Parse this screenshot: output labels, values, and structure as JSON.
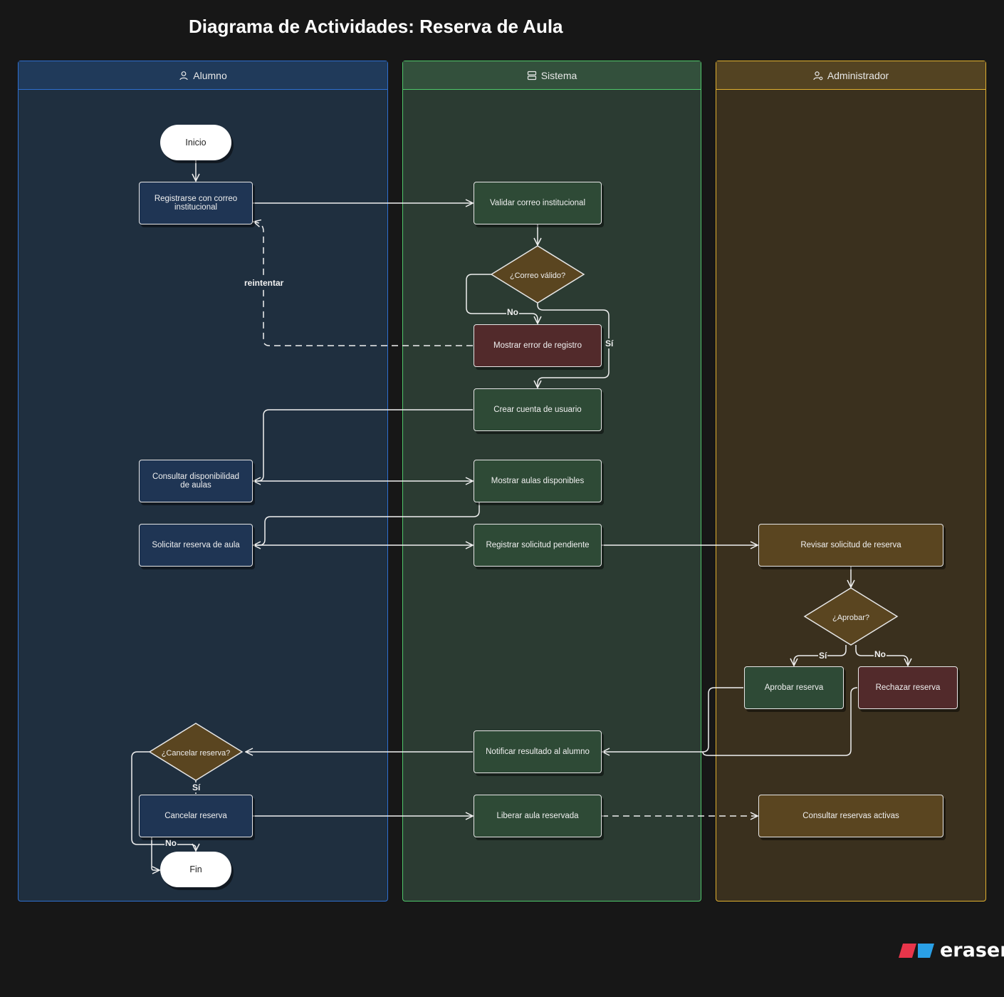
{
  "title": "Diagrama de Actividades: Reserva de Aula",
  "colors": {
    "background": "#171717",
    "alumno_lane_bg": "#1f2f3f",
    "alumno_lane_border": "#2f6fd0",
    "sistema_lane_bg": "#2b3b32",
    "sistema_lane_border": "#4fc76a",
    "admin_lane_bg": "#3a301e",
    "admin_lane_border": "#e0b030",
    "blue_node": "#1f3554",
    "green_node": "#2e4a36",
    "red_node": "#522a2b",
    "gold_node": "#5a4520"
  },
  "lanes": [
    {
      "label": "Alumno",
      "icon": "user-icon"
    },
    {
      "label": "Sistema",
      "icon": "server-icon"
    },
    {
      "label": "Administrador",
      "icon": "user-gear-icon"
    }
  ],
  "nodes": {
    "inicio": "Inicio",
    "registrarse": "Registrarse con correo institucional",
    "validar": "Validar correo institucional",
    "correo_valido": "¿Correo válido?",
    "mostrar_error": "Mostrar error de registro",
    "crear_cuenta": "Crear cuenta de usuario",
    "consultar_disponibilidad": "Consultar disponibilidad de aulas",
    "mostrar_aulas": "Mostrar aulas disponibles",
    "solicitar_reserva": "Solicitar reserva de aula",
    "registrar_solicitud": "Registrar solicitud pendiente",
    "revisar_solicitud": "Revisar solicitud de reserva",
    "aprobar_q": "¿Aprobar?",
    "aprobar_reserva": "Aprobar reserva",
    "rechazar_reserva": "Rechazar reserva",
    "notificar": "Notificar resultado al alumno",
    "cancelar_q": "¿Cancelar reserva?",
    "cancelar_reserva": "Cancelar reserva",
    "liberar_aula": "Liberar aula reservada",
    "consultar_activas": "Consultar reservas activas",
    "fin": "Fin"
  },
  "edge_labels": {
    "reintentar": "reintentar",
    "correo_no": "No",
    "correo_si": "Sí",
    "aprobar_si": "Sí",
    "aprobar_no": "No",
    "cancelar_si": "Sí",
    "cancelar_no": "No"
  },
  "brand": "eraser"
}
